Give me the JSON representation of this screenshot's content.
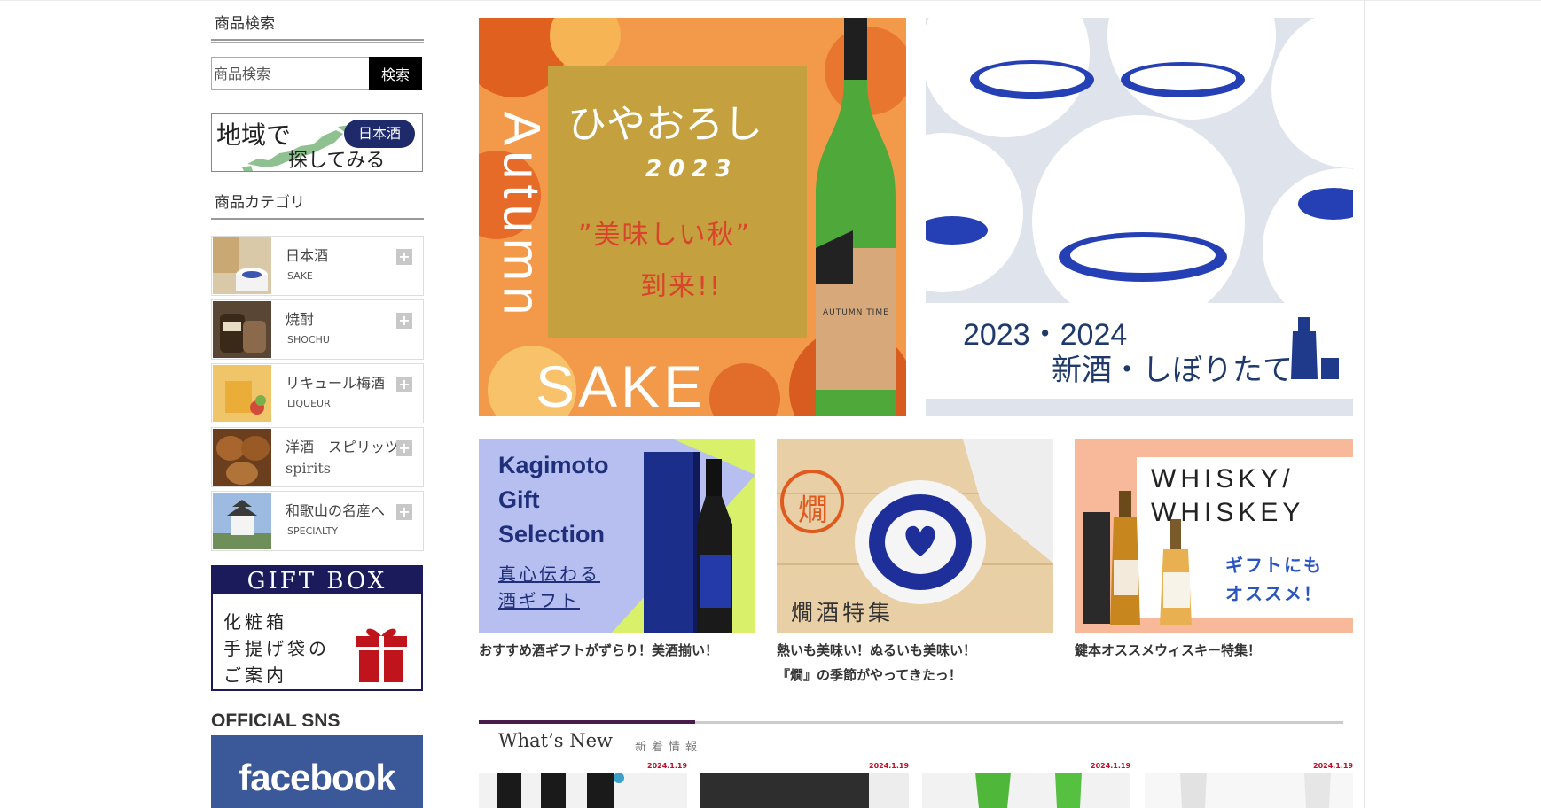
{
  "sidebar": {
    "search_heading": "商品検索",
    "search_placeholder": "商品検索",
    "search_button": "検索",
    "region_banner": {
      "text_main": "地域で",
      "text_sub": "探してみる",
      "badge": "日本酒"
    },
    "category_heading": "商品カテゴリ",
    "categories": [
      {
        "jp": "日本酒",
        "en": "SAKE"
      },
      {
        "jp": "焼酎",
        "en": "SHOCHU"
      },
      {
        "jp": "リキュール梅酒",
        "en": "LIQUEUR"
      },
      {
        "jp": "洋酒　スピリッツ",
        "en": "spirits"
      },
      {
        "jp": "和歌山の名産へ",
        "en": "SPECIALTY"
      }
    ],
    "giftbox": {
      "head": "GIFT BOX",
      "line1": "化粧箱",
      "line2": "手提げ袋の",
      "line3": "ご案内"
    },
    "sns_title": "OFFICIAL SNS",
    "facebook_label": "facebook"
  },
  "hero": {
    "left": {
      "vertical": "Autumn",
      "title": "ひやおろし",
      "year": "2023",
      "line1": "”美味しい秋”",
      "line2": "到来!!",
      "bottom": "SAKE",
      "bottle_label": "AUTUMN TIME"
    },
    "right": {
      "years": "2023・2024",
      "title": "新酒・しぼりたて"
    }
  },
  "promos": [
    {
      "banner_lines": [
        "Kagimoto",
        "Gift",
        "Selection"
      ],
      "banner_sub1": "真心伝わる",
      "banner_sub2": "酒ギフト",
      "caption": "おすすめ酒ギフトがずらり！美酒揃い！"
    },
    {
      "banner_text": "燗酒特集",
      "stamp": "燗",
      "caption1": "熱いも美味い！ぬるいも美味い！",
      "caption2": "『燗』の季節がやってきたっ！"
    },
    {
      "banner_line1": "WHISKY/",
      "banner_line2": "WHISKEY",
      "banner_sub1": "ギフトにも",
      "banner_sub2": "オススメ！",
      "caption": "鍵本オススメウィスキー特集！"
    }
  ],
  "whats_new": {
    "title": "What’s New",
    "subtitle": "新着情報",
    "dates": [
      "2024.1.19",
      "2024.1.19",
      "2024.1.19",
      "2024.1.19"
    ]
  },
  "colors": {
    "accent": "#4b1a4d",
    "search_button": "#000000",
    "facebook": "#3b5998",
    "date": "#c0102a"
  }
}
